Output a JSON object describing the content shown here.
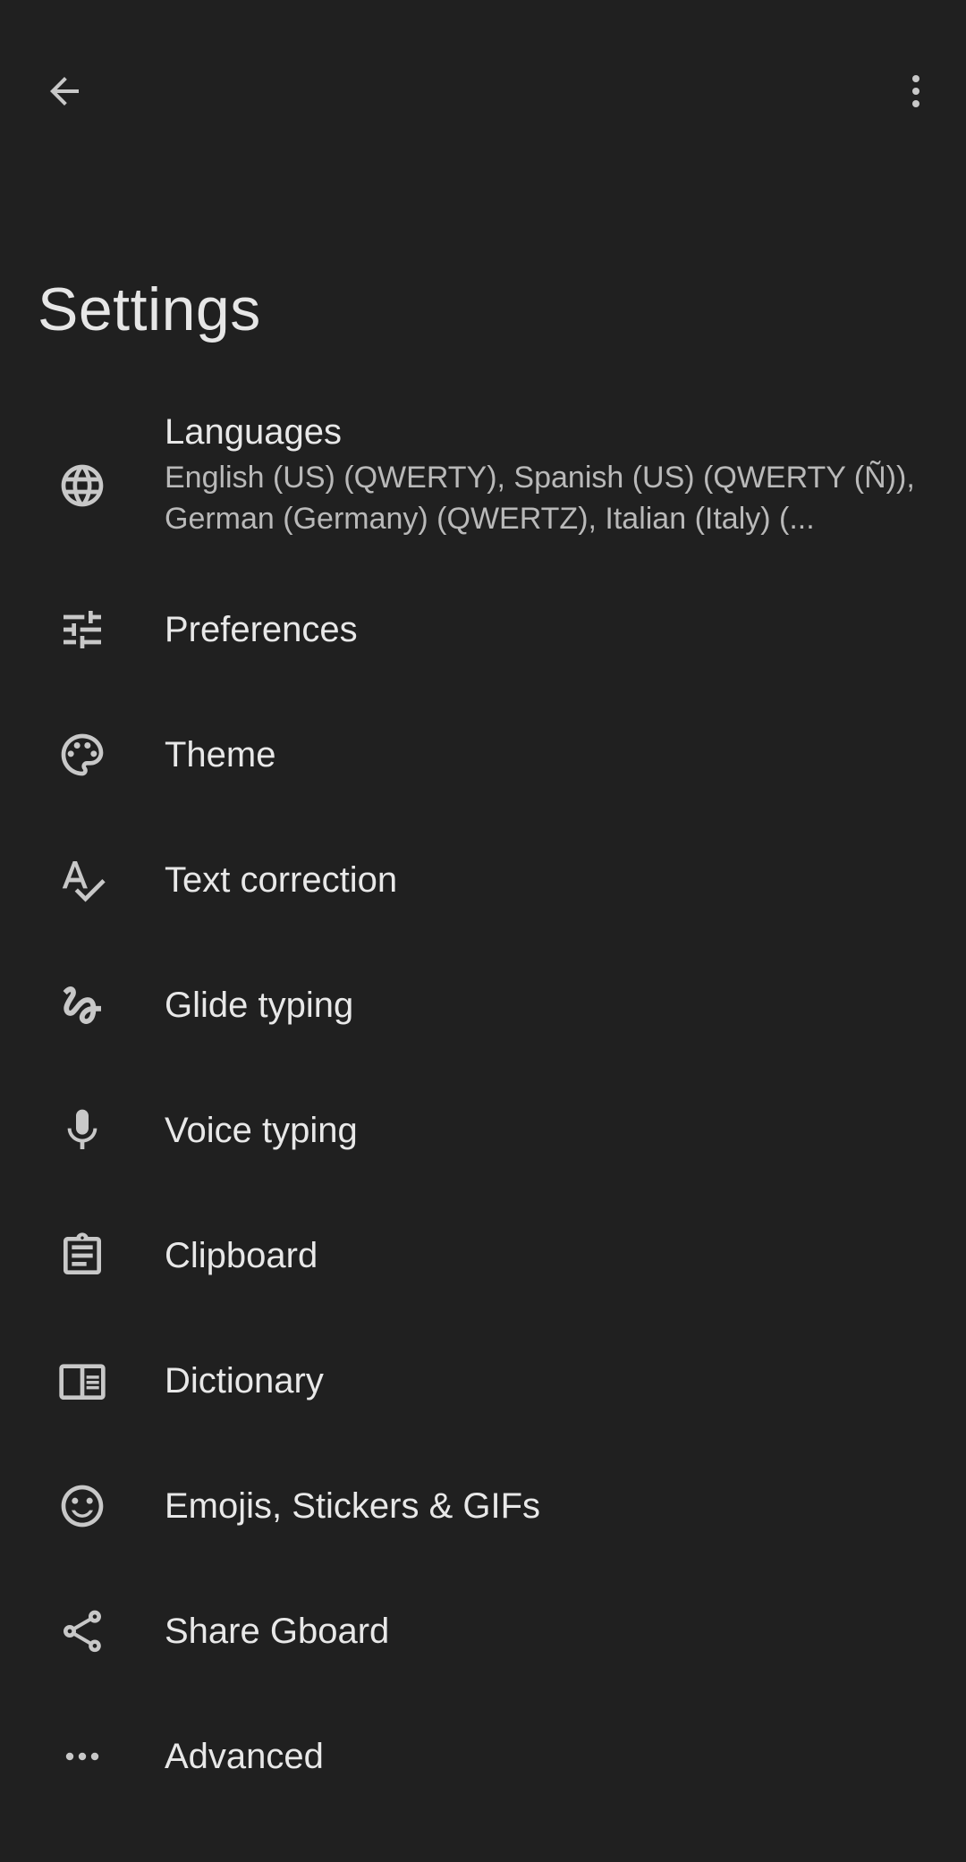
{
  "header": {
    "back_icon": "arrow-back-icon",
    "more_icon": "more-vert-icon",
    "title": "Settings"
  },
  "colors": {
    "background": "#202020",
    "text_primary": "#e8e8e8",
    "text_secondary": "#b9b9b9",
    "icon": "#c8c8c8"
  },
  "items": [
    {
      "id": "languages",
      "icon": "globe-icon",
      "label": "Languages",
      "summary": "English (US) (QWERTY), Spanish (US) (QWERTY (Ñ)), German (Germany) (QWERTZ), Italian (Italy) (..."
    },
    {
      "id": "preferences",
      "icon": "tune-icon",
      "label": "Preferences"
    },
    {
      "id": "theme",
      "icon": "palette-icon",
      "label": "Theme"
    },
    {
      "id": "text-correction",
      "icon": "spellcheck-icon",
      "label": "Text correction"
    },
    {
      "id": "glide-typing",
      "icon": "gesture-icon",
      "label": "Glide typing"
    },
    {
      "id": "voice-typing",
      "icon": "mic-icon",
      "label": "Voice typing"
    },
    {
      "id": "clipboard",
      "icon": "clipboard-icon",
      "label": "Clipboard"
    },
    {
      "id": "dictionary",
      "icon": "book-icon",
      "label": "Dictionary"
    },
    {
      "id": "emojis",
      "icon": "emoji-icon",
      "label": "Emojis, Stickers & GIFs"
    },
    {
      "id": "share-gboard",
      "icon": "share-icon",
      "label": "Share Gboard"
    },
    {
      "id": "advanced",
      "icon": "more-horiz-icon",
      "label": "Advanced"
    }
  ]
}
